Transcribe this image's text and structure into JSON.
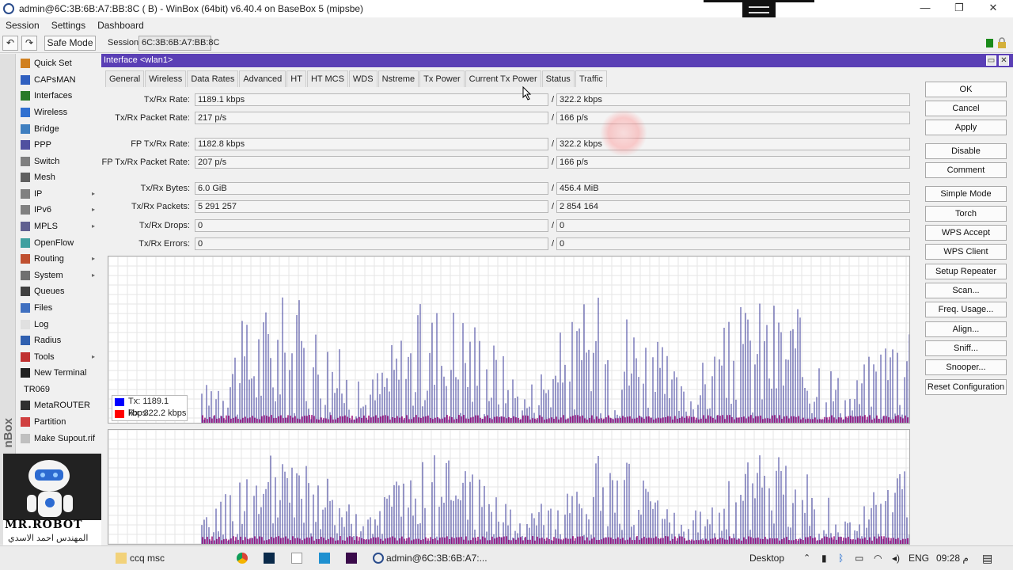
{
  "window": {
    "title": "admin@6C:3B:6B:A7:BB:8C ( B) - WinBox (64bit) v6.40.4 on BaseBox 5 (mipsbe)",
    "minimize": "—",
    "maximize": "❐",
    "close": "✕"
  },
  "menubar": [
    "Session",
    "Settings",
    "Dashboard"
  ],
  "toolbar": {
    "undo": "↶",
    "redo": "↷",
    "safe_mode": "Safe Mode",
    "session_label": "Session:",
    "session_value": "6C:3B:6B:A7:BB:8C"
  },
  "sidebar": {
    "vertical_text": "nBox",
    "items": [
      {
        "label": "Quick Set",
        "icon": "quickset-icon",
        "color": "#d08020",
        "arrow": false
      },
      {
        "label": "CAPsMAN",
        "icon": "capsman-icon",
        "color": "#3060c0",
        "arrow": false
      },
      {
        "label": "Interfaces",
        "icon": "interfaces-icon",
        "color": "#2a7a2a",
        "arrow": false
      },
      {
        "label": "Wireless",
        "icon": "wireless-icon",
        "color": "#3070d0",
        "arrow": false
      },
      {
        "label": "Bridge",
        "icon": "bridge-icon",
        "color": "#4080c0",
        "arrow": false
      },
      {
        "label": "PPP",
        "icon": "ppp-icon",
        "color": "#5050a0",
        "arrow": false
      },
      {
        "label": "Switch",
        "icon": "switch-icon",
        "color": "#808080",
        "arrow": false
      },
      {
        "label": "Mesh",
        "icon": "mesh-icon",
        "color": "#606060",
        "arrow": false
      },
      {
        "label": "IP",
        "icon": "ip-icon",
        "color": "#808080",
        "arrow": true
      },
      {
        "label": "IPv6",
        "icon": "ipv6-icon",
        "color": "#808080",
        "arrow": true
      },
      {
        "label": "MPLS",
        "icon": "mpls-icon",
        "color": "#606090",
        "arrow": true
      },
      {
        "label": "OpenFlow",
        "icon": "openflow-icon",
        "color": "#40a0a0",
        "arrow": false
      },
      {
        "label": "Routing",
        "icon": "routing-icon",
        "color": "#c05030",
        "arrow": true
      },
      {
        "label": "System",
        "icon": "system-icon",
        "color": "#707070",
        "arrow": true
      },
      {
        "label": "Queues",
        "icon": "queues-icon",
        "color": "#404040",
        "arrow": false
      },
      {
        "label": "Files",
        "icon": "files-icon",
        "color": "#4070c0",
        "arrow": false
      },
      {
        "label": "Log",
        "icon": "log-icon",
        "color": "#e0e0e0",
        "arrow": false
      },
      {
        "label": "Radius",
        "icon": "radius-icon",
        "color": "#3060b0",
        "arrow": false
      },
      {
        "label": "Tools",
        "icon": "tools-icon",
        "color": "#c03030",
        "arrow": true
      },
      {
        "label": "New Terminal",
        "icon": "terminal-icon",
        "color": "#202020",
        "arrow": false
      },
      {
        "label": "TR069",
        "icon": "",
        "color": "",
        "arrow": false
      },
      {
        "label": "MetaROUTER",
        "icon": "metarouter-icon",
        "color": "#303030",
        "arrow": false
      },
      {
        "label": "Partition",
        "icon": "partition-icon",
        "color": "#d04040",
        "arrow": false
      },
      {
        "label": "Make Supout.rif",
        "icon": "supout-icon",
        "color": "#c0c0c0",
        "arrow": false
      }
    ]
  },
  "robot_logo": {
    "text": "MR.ROBOT",
    "subtext": "المهندس احمد الاسدي"
  },
  "interface_window": {
    "title": "Interface <wlan1>",
    "tabs": [
      "General",
      "Wireless",
      "Data Rates",
      "Advanced",
      "HT",
      "HT MCS",
      "WDS",
      "Nstreme",
      "Tx Power",
      "Current Tx Power",
      "Status",
      "Traffic"
    ],
    "active_tab": "Traffic",
    "fields": [
      {
        "label": "Tx/Rx Rate:",
        "tx": "1189.1 kbps",
        "rx": "322.2 kbps"
      },
      {
        "label": "Tx/Rx Packet Rate:",
        "tx": "217 p/s",
        "rx": "166 p/s"
      },
      {
        "label": "FP Tx/Rx Rate:",
        "tx": "1182.8 kbps",
        "rx": "322.2 kbps"
      },
      {
        "label": "FP Tx/Rx Packet Rate:",
        "tx": "207 p/s",
        "rx": "166 p/s"
      },
      {
        "label": "Tx/Rx Bytes:",
        "tx": "6.0 GiB",
        "rx": "456.4 MiB"
      },
      {
        "label": "Tx/Rx Packets:",
        "tx": "5 291 257",
        "rx": "2 854 164"
      },
      {
        "label": "Tx/Rx Drops:",
        "tx": "0",
        "rx": "0"
      },
      {
        "label": "Tx/Rx Errors:",
        "tx": "0",
        "rx": "0"
      }
    ],
    "slash": "/",
    "legend": [
      {
        "label": "Tx:",
        "value": "1189.1 kbps",
        "color": "#0000ff"
      },
      {
        "label": "Rx:",
        "value": "322.2 kbps",
        "color": "#ff0000"
      }
    ],
    "buttons": [
      "OK",
      "Cancel",
      "Apply",
      "Disable",
      "Comment",
      "Simple Mode",
      "Torch",
      "WPS Accept",
      "WPS Client",
      "Setup Repeater",
      "Scan...",
      "Freq. Usage...",
      "Align...",
      "Sniff...",
      "Snooper...",
      "Reset Configuration"
    ]
  },
  "taskbar": {
    "items": [
      {
        "label": "ccq msc",
        "icon": "folder-icon"
      },
      {
        "label": "admin@6C:3B:6B:A7:...",
        "icon": "winbox-icon"
      }
    ],
    "desktop": "Desktop",
    "lang": "ENG",
    "time": "09:28 م"
  }
}
